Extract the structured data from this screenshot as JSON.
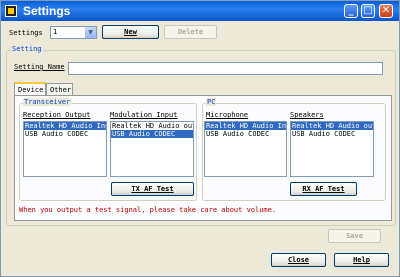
{
  "window": {
    "title": "Settings",
    "min": "_",
    "max": "□",
    "close": "✕"
  },
  "settings_row": {
    "label": "Settings",
    "selected": "1",
    "new_label": "New",
    "delete_label": "Delete"
  },
  "setting_group": {
    "title": "Setting",
    "name_label": "Setting Name",
    "name_value": ""
  },
  "tabs": [
    {
      "label": "Device"
    },
    {
      "label": "Other"
    }
  ],
  "transceiver": {
    "title": "Transceiver",
    "reception_label": "Reception Output",
    "reception_items": [
      "Realtek HD Audio Inp",
      "USB Audio CODEC"
    ],
    "modulation_label": "Modulation Input",
    "modulation_items": [
      "Realtek HD Audio out",
      "USB Audio CODEC"
    ],
    "test_button": "TX AF Test"
  },
  "pc": {
    "title": "PC",
    "microphone_label": "Microphone",
    "microphone_items": [
      "Realtek HD Audio Inp",
      "USB Audio CODEC"
    ],
    "speakers_label": "Speakers",
    "speakers_items": [
      "Realtek HD Audio out",
      "USB Audio CODEC"
    ],
    "test_button": "RX AF Test"
  },
  "warning": "When you output a test signal, please take care about volume.",
  "footer": {
    "save_label": "Save",
    "close_label": "Close",
    "help_label": "Help"
  },
  "colors": {
    "title_bar": "#0a5fd8",
    "selection": "#316ac5",
    "warning": "#c00000",
    "group_title": "#0046d5"
  }
}
